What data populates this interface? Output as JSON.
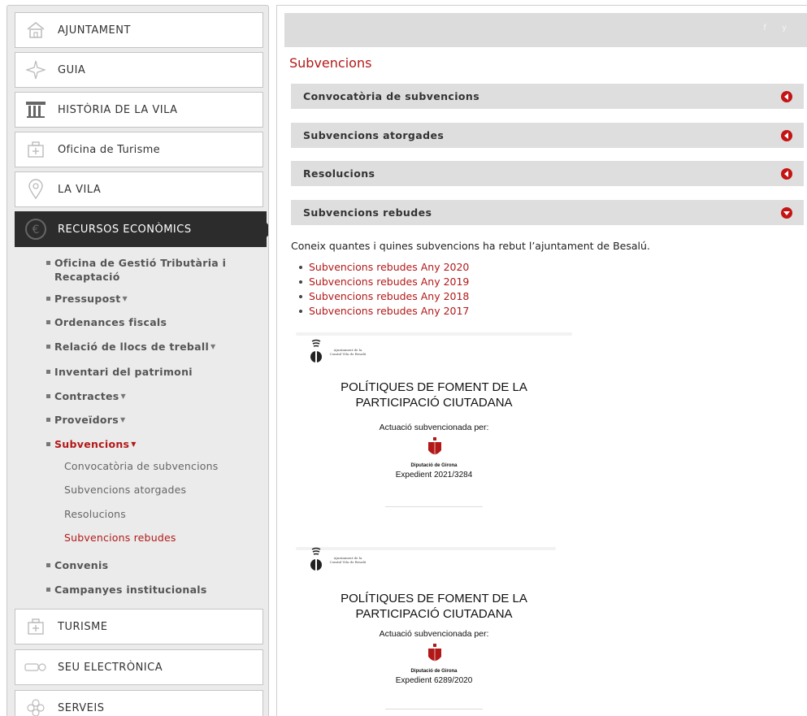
{
  "sidebar": {
    "nav": [
      {
        "label": "AJUNTAMENT",
        "icon": "town-hall-icon"
      },
      {
        "label": "GUIA",
        "icon": "compass-icon"
      },
      {
        "label": "HISTÒRIA DE LA VILA",
        "icon": "column-icon"
      },
      {
        "label": "Oficina de Turisme",
        "icon": "tourism-office-icon"
      },
      {
        "label": "LA VILA",
        "icon": "map-pin-icon"
      },
      {
        "label": "RECURSOS ECONÒMICS",
        "icon": "euro-coin-icon"
      },
      {
        "label": "TURISME",
        "icon": "tourism-icon"
      },
      {
        "label": "SEU ELECTRÒNICA",
        "icon": "e-office-icon"
      },
      {
        "label": "SERVEIS",
        "icon": "services-icon"
      }
    ],
    "submenu": [
      {
        "label": "Oficina de Gestió Tributària i Recaptació"
      },
      {
        "label": "Pressupost",
        "caret": "▼"
      },
      {
        "label": "Ordenances fiscals"
      },
      {
        "label": "Relació de llocs de treball",
        "caret": "▼"
      },
      {
        "label": "Inventari del patrimoni"
      },
      {
        "label": "Contractes",
        "caret": "▼"
      },
      {
        "label": "Proveïdors",
        "caret": "▼"
      },
      {
        "label": "Subvencions",
        "caret": "▼"
      },
      {
        "label": "Convenis"
      },
      {
        "label": "Campanyes institucionals"
      }
    ],
    "subsubmenu": [
      {
        "label": "Convocatòria de subvencions"
      },
      {
        "label": "Subvencions atorgades"
      },
      {
        "label": "Resolucions"
      },
      {
        "label": "Subvencions rebudes"
      }
    ]
  },
  "topbar": {
    "social": "f  y"
  },
  "main": {
    "title": "Subvencions",
    "accordion": [
      {
        "label": "Convocatòria de subvencions",
        "state": "collapsed"
      },
      {
        "label": "Subvencions atorgades",
        "state": "collapsed"
      },
      {
        "label": "Resolucions",
        "state": "collapsed"
      },
      {
        "label": "Subvencions rebudes",
        "state": "expanded"
      }
    ],
    "intro": "Coneix quantes i quines subvencions ha rebut l’ajuntament de Besalú.",
    "links": [
      "Subvencions rebudes Any 2020",
      "Subvencions rebudes Any 2019",
      "Subvencions rebudes Any 2018",
      "Subvencions rebudes Any 2017"
    ],
    "posters": [
      {
        "logo_text": "Ajuntament de la Comtal Vila de Besalú",
        "title_line1": "POLÍTIQUES DE FOMENT DE LA",
        "title_line2": "PARTICIPACIÓ CIUTADANA",
        "subtitle": "Actuació subvencionada per:",
        "funder": "Diputació de Girona",
        "expedient": "Expedient  2021/3284"
      },
      {
        "logo_text": "Ajuntament de la Comtal Vila de Besalú",
        "title_line1": "POLÍTIQUES DE FOMENT DE LA",
        "title_line2": "PARTICIPACIÓ CIUTADANA",
        "subtitle": "Actuació subvencionada per:",
        "funder": "Diputació de Girona",
        "expedient": "Expedient 6289/2020"
      }
    ]
  },
  "colors": {
    "accent": "#b31818",
    "active_nav": "#2c2c2c",
    "accordion_bg": "#dedede",
    "sidebar_bg": "#ebebeb"
  }
}
